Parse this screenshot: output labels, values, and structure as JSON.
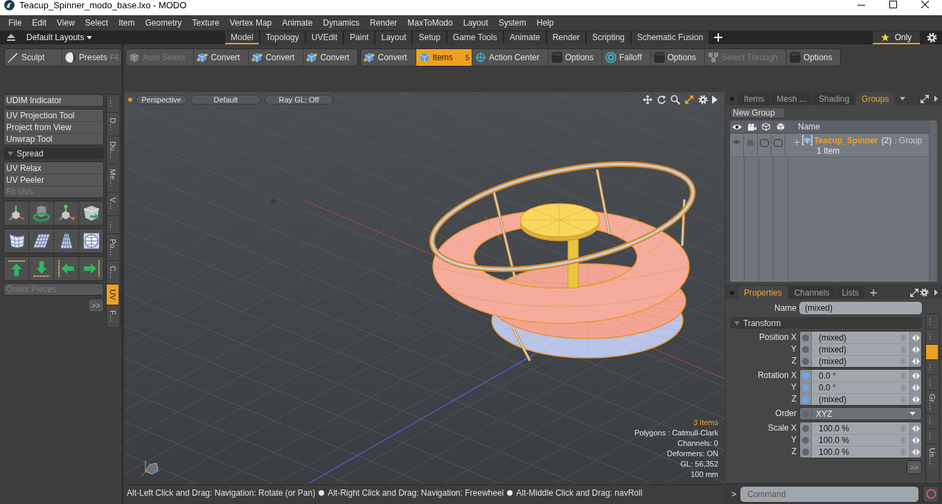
{
  "window": {
    "title": "Teacup_Spinner_modo_base.lxo - MODO"
  },
  "menu": [
    "File",
    "Edit",
    "View",
    "Select",
    "Item",
    "Geometry",
    "Texture",
    "Vertex Map",
    "Animate",
    "Dynamics",
    "Render",
    "MaxToModo",
    "Layout",
    "System",
    "Help"
  ],
  "layout_bar": {
    "layouts": "Default Layouts",
    "tabs": [
      {
        "label": "Model",
        "selected": true
      },
      {
        "label": "Topology",
        "selected": false
      },
      {
        "label": "UVEdit",
        "selected": false
      },
      {
        "label": "Paint",
        "selected": false
      },
      {
        "label": "Layout",
        "selected": false
      },
      {
        "label": "Setup",
        "selected": false
      },
      {
        "label": "Game Tools",
        "selected": false
      },
      {
        "label": "Animate",
        "selected": false
      },
      {
        "label": "Render",
        "selected": false
      },
      {
        "label": "Scripting",
        "selected": false
      },
      {
        "label": "Schematic Fusion",
        "selected": false
      }
    ],
    "filter": {
      "label": "Only",
      "on": true
    }
  },
  "toolbar": {
    "left": [
      {
        "label": "Sculpt"
      },
      {
        "label": "Presets",
        "shortcut": "F6"
      }
    ],
    "groups": [
      {
        "items": [
          {
            "label": "Auto Select",
            "selected": false,
            "disabled": true
          },
          {
            "label": "Convert",
            "selected": false,
            "disabled": false
          },
          {
            "label": "Convert",
            "selected": false,
            "disabled": false
          },
          {
            "label": "Convert",
            "selected": false,
            "disabled": false
          }
        ]
      },
      {
        "items": [
          {
            "label": "Convert",
            "selected": false,
            "disabled": false
          },
          {
            "label": "Items",
            "shortcut": "5",
            "selected": true,
            "disabled": false
          },
          {
            "label": "Action Center",
            "selected": false,
            "disabled": false
          },
          {
            "label": "Options",
            "selected": false,
            "disabled": false
          },
          {
            "label": "Falloff",
            "selected": false,
            "disabled": false
          },
          {
            "label": "Options",
            "selected": false,
            "disabled": false
          },
          {
            "label": "Select Through",
            "selected": false,
            "disabled": true
          },
          {
            "label": "Options",
            "selected": false,
            "disabled": false
          }
        ]
      }
    ]
  },
  "toolbox": {
    "indicator": "UDIM Indicator",
    "tools": [
      {
        "label": "UV Projection Tool",
        "disabled": false
      },
      {
        "label": "Project from View",
        "disabled": false
      },
      {
        "label": "Unwrap Tool",
        "disabled": false
      }
    ],
    "section": {
      "label": "Spread",
      "expanded": true
    },
    "section_tools": [
      {
        "label": "UV Relax",
        "disabled": false
      },
      {
        "label": "UV Peeler",
        "disabled": false
      },
      {
        "label": "Fit UVs",
        "disabled": true
      }
    ],
    "orient": {
      "label": "Orient Pieces",
      "disabled": true
    },
    "more": ">>",
    "side_tabs": [
      {
        "label": "…",
        "selected": false
      },
      {
        "label": "D…",
        "selected": false
      },
      {
        "label": "Du…",
        "selected": false
      },
      {
        "label": "Me…",
        "selected": false
      },
      {
        "label": "V…",
        "selected": false
      },
      {
        "label": "…",
        "selected": false
      },
      {
        "label": "Po…",
        "selected": false
      },
      {
        "label": "C…",
        "selected": false
      },
      {
        "label": "UV",
        "selected": true
      },
      {
        "label": "F…",
        "selected": false
      }
    ]
  },
  "viewport": {
    "pills": [
      "Perspective",
      "Default",
      "Ray GL: Off"
    ],
    "info": [
      {
        "text": "3 Items",
        "highlight": true
      },
      {
        "text": "Polygons : Catmull-Clark",
        "highlight": false
      },
      {
        "text": "Channels: 0",
        "highlight": false
      },
      {
        "text": "Deformers: ON",
        "highlight": false
      },
      {
        "text": "GL: 56,352",
        "highlight": false
      },
      {
        "text": "100 mm",
        "highlight": false
      }
    ]
  },
  "status_bar": {
    "hints": [
      "Alt-Left Click and Drag: Navigation: Rotate (or Pan)",
      "Alt-Right Click and Drag: Navigation: Freewheel",
      "Alt-Middle Click and Drag: navRoll"
    ]
  },
  "groups_panel": {
    "tabs": [
      {
        "label": "Items",
        "selected": false
      },
      {
        "label": "Mesh ...",
        "selected": false
      },
      {
        "label": "Shading",
        "selected": false
      },
      {
        "label": "Groups",
        "selected": true
      }
    ],
    "new_group": "New Group",
    "name_column": "Name",
    "rows": [
      {
        "name": "Teacup_Spinner",
        "count": "(2)",
        "type": ": Group",
        "detail": "1 Item"
      }
    ]
  },
  "properties_panel": {
    "tabs": [
      {
        "label": "Properties",
        "selected": true
      },
      {
        "label": "Channels",
        "selected": false
      },
      {
        "label": "Lists",
        "selected": false
      }
    ],
    "name": {
      "label": "Name",
      "value": "(mixed)"
    },
    "section": {
      "label": "Transform",
      "expanded": true
    },
    "blocks": [
      {
        "kind": "vector",
        "rows": [
          {
            "label": "Position X",
            "value": "(mixed)",
            "color": "#5f656b"
          },
          {
            "label": "Y",
            "value": "(mixed)",
            "color": "#5f656b"
          },
          {
            "label": "Z",
            "value": "(mixed)",
            "color": "#5f656b"
          }
        ]
      },
      {
        "kind": "vector",
        "rows": [
          {
            "label": "Rotation X",
            "value": "0.0 °",
            "color": "#6fa6ec"
          },
          {
            "label": "Y",
            "value": "0.0 °",
            "color": "#6fa6ec"
          },
          {
            "label": "Z",
            "value": "(mixed)",
            "color": "#6fa6ec"
          }
        ]
      },
      {
        "kind": "choice",
        "label": "Order",
        "value": "XYZ",
        "color": "#5f656b"
      },
      {
        "kind": "vector",
        "rows": [
          {
            "label": "Scale X",
            "value": "100.0 %",
            "color": "#5f656b"
          },
          {
            "label": "Y",
            "value": "100.0 %",
            "color": "#5f656b"
          },
          {
            "label": "Z",
            "value": "100.0 %",
            "color": "#5f656b"
          }
        ]
      }
    ],
    "more": ">>",
    "side_tabs": [
      {
        "label": "…",
        "selected": false
      },
      {
        "label": "…",
        "selected": false
      },
      {
        "selected": true
      },
      {
        "label": "…",
        "selected": false
      },
      {
        "label": "…",
        "selected": false
      },
      {
        "label": "Gr…",
        "selected": false
      },
      {
        "label": "…",
        "selected": false
      },
      {
        "label": "…",
        "selected": false
      },
      {
        "label": "Us…",
        "selected": false
      }
    ]
  },
  "command": {
    "prompt": ">",
    "placeholder": "Command"
  }
}
